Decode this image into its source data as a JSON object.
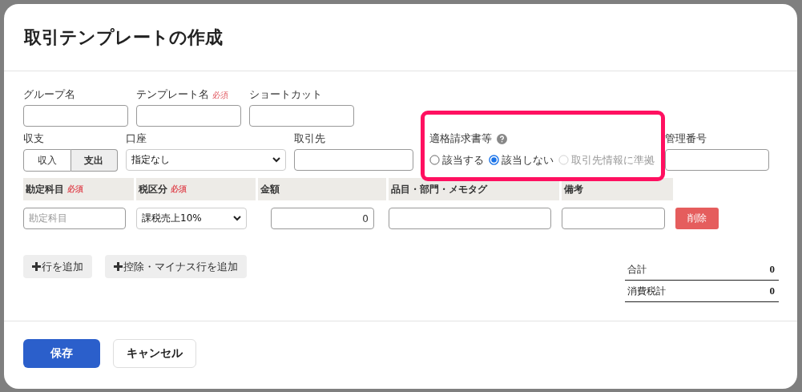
{
  "dialog": {
    "title": "取引テンプレートの作成"
  },
  "top_fields": [
    {
      "label": "グループ名"
    },
    {
      "label": "テンプレート名",
      "badge": "必須"
    },
    {
      "label": "ショートカット"
    }
  ],
  "income_expense": {
    "label": "収支",
    "options": [
      {
        "label": "収入",
        "selected": false
      },
      {
        "label": "支出",
        "selected": true
      }
    ]
  },
  "account": {
    "label": "口座",
    "value": "指定なし"
  },
  "partner": {
    "label": "取引先"
  },
  "invoice": {
    "label": "適格請求書等",
    "highlighted": true,
    "options": [
      {
        "label": "該当する",
        "selected": false,
        "disabled": false
      },
      {
        "label": "該当しない",
        "selected": true,
        "disabled": false
      },
      {
        "label": "取引先情報に準拠",
        "selected": false,
        "disabled": true
      }
    ]
  },
  "management_number": {
    "label": "管理番号"
  },
  "table": {
    "columns": [
      {
        "label": "勘定科目",
        "badge": "必須"
      },
      {
        "label": "税区分",
        "badge": "必須"
      },
      {
        "label": "金額"
      },
      {
        "label": "品目・部門・メモタグ"
      },
      {
        "label": "備考"
      }
    ],
    "rows": [
      {
        "account_placeholder": "勘定科目",
        "tax": "課税売上10%",
        "amount": "0",
        "delete": "削除"
      }
    ]
  },
  "add_buttons": [
    "行を追加",
    "控除・マイナス行を追加"
  ],
  "totals": [
    {
      "label": "合計",
      "value": "0"
    },
    {
      "label": "消費税計",
      "value": "0"
    }
  ],
  "buttons": [
    {
      "label": "保存",
      "kind": "primary"
    },
    {
      "label": "キャンセル",
      "kind": "secondary"
    }
  ]
}
